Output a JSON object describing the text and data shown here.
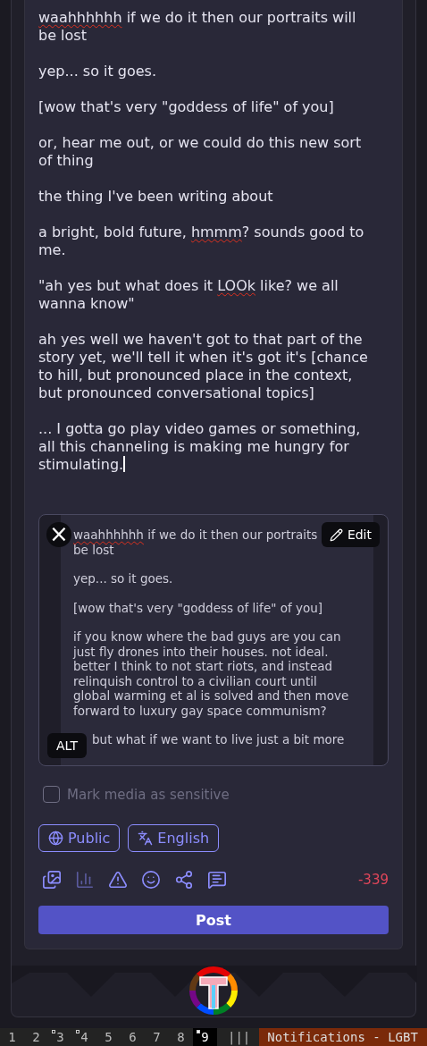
{
  "composer": {
    "paragraphs": [
      [
        [
          {
            "kind": "misspelled",
            "text": "waahhhhhh"
          },
          {
            "kind": "plain",
            "text": " if we do it then our portraits will"
          }
        ],
        [
          {
            "kind": "plain",
            "text": "be lost"
          }
        ]
      ],
      [
        [
          {
            "kind": "plain",
            "text": "yep... so it goes."
          }
        ]
      ],
      [
        [
          {
            "kind": "plain",
            "text": "[wow that's very \"goddess of life\" of you]"
          }
        ]
      ],
      [
        [
          {
            "kind": "plain",
            "text": "or, hear me out, or we could do this new sort"
          }
        ],
        [
          {
            "kind": "plain",
            "text": "of thing"
          }
        ]
      ],
      [
        [
          {
            "kind": "plain",
            "text": "the thing I've been writing about"
          }
        ]
      ],
      [
        [
          {
            "kind": "plain",
            "text": "a bright, bold future, "
          },
          {
            "kind": "misspelled",
            "text": "hmmm"
          },
          {
            "kind": "plain",
            "text": "? sounds good to"
          }
        ],
        [
          {
            "kind": "plain",
            "text": "me."
          }
        ]
      ],
      [
        [
          {
            "kind": "plain",
            "text": "\"ah yes but what does it "
          },
          {
            "kind": "misspelled",
            "text": "LOOk"
          },
          {
            "kind": "plain",
            "text": " like? we all"
          }
        ],
        [
          {
            "kind": "plain",
            "text": "wanna know\""
          }
        ]
      ],
      [
        [
          {
            "kind": "plain",
            "text": "ah yes well we haven't got to that part of the"
          }
        ],
        [
          {
            "kind": "plain",
            "text": "story yet, we'll tell it when it's got it's [chance"
          }
        ],
        [
          {
            "kind": "plain",
            "text": "to hill, but pronounced place in the context,"
          }
        ],
        [
          {
            "kind": "plain",
            "text": "but pronounced conversational topics]"
          }
        ]
      ],
      [
        [
          {
            "kind": "plain",
            "text": "... I gotta go play video games or something,"
          }
        ],
        [
          {
            "kind": "plain",
            "text": "all this channeling is making me hungry for"
          }
        ],
        [
          {
            "kind": "plain",
            "text": "stimulating."
          }
        ]
      ]
    ],
    "attachment": {
      "close": "×",
      "edit": "Edit",
      "alt": "ALT",
      "paragraphs": [
        [
          [
            {
              "kind": "misspelled",
              "text": "waahhhhhh"
            },
            {
              "kind": "plain",
              "text": " if we do it then our portraits"
            }
          ],
          [
            {
              "kind": "plain",
              "text": "be lost"
            }
          ]
        ],
        [
          [
            {
              "kind": "plain",
              "text": "yep... so it goes."
            }
          ]
        ],
        [
          [
            {
              "kind": "plain",
              "text": "[wow that's very \"goddess of life\" of you]"
            }
          ]
        ],
        [
          [
            {
              "kind": "plain",
              "text": "if you know where the bad guys are you can"
            }
          ],
          [
            {
              "kind": "plain",
              "text": "just fly drones into their houses. not ideal."
            }
          ],
          [
            {
              "kind": "plain",
              "text": "better I think to not start riots, and instead"
            }
          ],
          [
            {
              "kind": "plain",
              "text": "relinquish control to a civilian court until"
            }
          ],
          [
            {
              "kind": "plain",
              "text": "global warming et al is solved and then move"
            }
          ],
          [
            {
              "kind": "plain",
              "text": "forward to luxury gay space communism?"
            }
          ]
        ],
        [
          [
            {
              "kind": "plain",
              "text": "but what if we want to live just a bit more"
            }
          ]
        ]
      ]
    },
    "sensitive": {
      "label": "Mark media as sensitive",
      "checked": false
    },
    "options": [
      {
        "kind": "visibility",
        "label": "Public"
      },
      {
        "kind": "language",
        "label": "English"
      }
    ],
    "tools": [
      {
        "kind": "media",
        "disabled": false
      },
      {
        "kind": "poll",
        "disabled": true
      },
      {
        "kind": "warning",
        "disabled": false
      },
      {
        "kind": "emoji",
        "disabled": false
      },
      {
        "kind": "share",
        "disabled": false
      },
      {
        "kind": "quote",
        "disabled": false
      }
    ],
    "counter": "-339",
    "post": "Post"
  },
  "taskbar": {
    "workspaces": [
      {
        "label": "1",
        "selected": false,
        "occupied": false
      },
      {
        "label": "2",
        "selected": false,
        "occupied": false
      },
      {
        "label": "3",
        "selected": false,
        "occupied": true
      },
      {
        "label": "4",
        "selected": false,
        "occupied": true
      },
      {
        "label": "5",
        "selected": false,
        "occupied": false
      },
      {
        "label": "6",
        "selected": false,
        "occupied": false
      },
      {
        "label": "7",
        "selected": false,
        "occupied": false
      },
      {
        "label": "8",
        "selected": false,
        "occupied": false
      },
      {
        "label": "9",
        "selected": true,
        "occupied": true
      }
    ],
    "layout": "|||",
    "window_title": "Notifications - LGBT"
  }
}
